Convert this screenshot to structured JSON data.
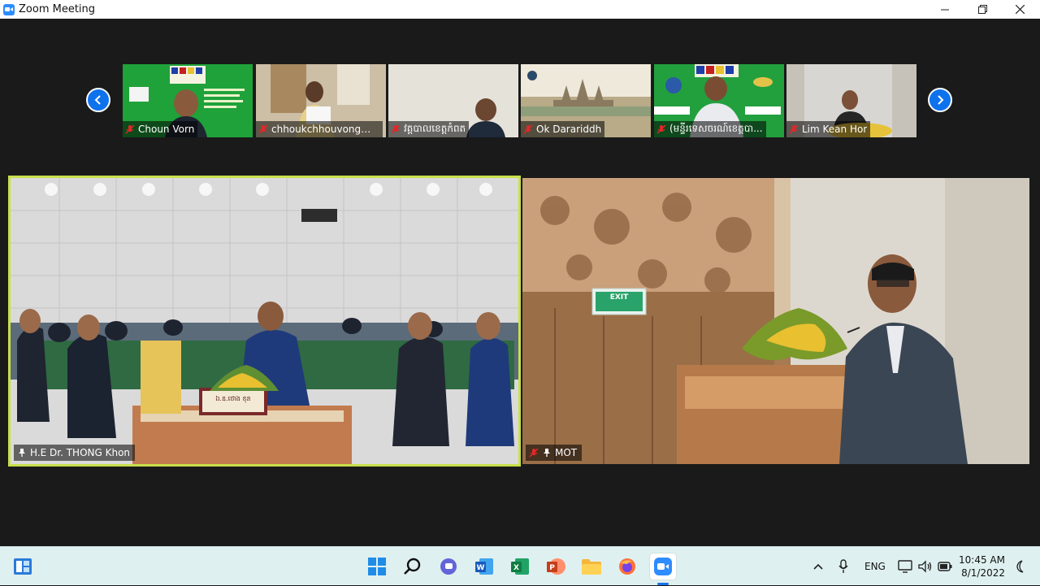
{
  "window": {
    "title": "Zoom Meeting",
    "controls": [
      "minimize",
      "restore",
      "close"
    ]
  },
  "gallery_strip": {
    "prev_icon": "chevron-left-icon",
    "next_icon": "chevron-right-icon",
    "participants": [
      {
        "name": "Choun Vorn",
        "muted": true
      },
      {
        "name": "chhoukchhouvong@g...",
        "muted": true
      },
      {
        "name": "វគ្គបាលខេត្តកំពត",
        "muted": true
      },
      {
        "name": "Ok Darariddh",
        "muted": true
      },
      {
        "name": "(មន្ទីរទេសចរណ៍ខេត្តបា...",
        "muted": true
      },
      {
        "name": "Lim Kean Hor",
        "muted": true
      }
    ]
  },
  "main_tiles": [
    {
      "name": "H.E Dr. THONG Khon",
      "pinned": true,
      "active_speaker": true,
      "sign_text": "ឯ.ឧ.ថោង ខុន"
    },
    {
      "name": "MOT",
      "muted": true,
      "pinned": true,
      "exit_sign": "EXIT"
    }
  ],
  "colors": {
    "active_speaker_border": "#c8e04b",
    "arrow_blue": "#0e72ed",
    "mute_red": "#e02828"
  },
  "taskbar": {
    "apps": [
      "windows-start",
      "search",
      "chat",
      "word",
      "excel",
      "powerpoint",
      "file-explorer",
      "firefox",
      "zoom"
    ],
    "tray": {
      "language": "ENG",
      "time": "10:45 AM",
      "date": "8/1/2022"
    }
  }
}
